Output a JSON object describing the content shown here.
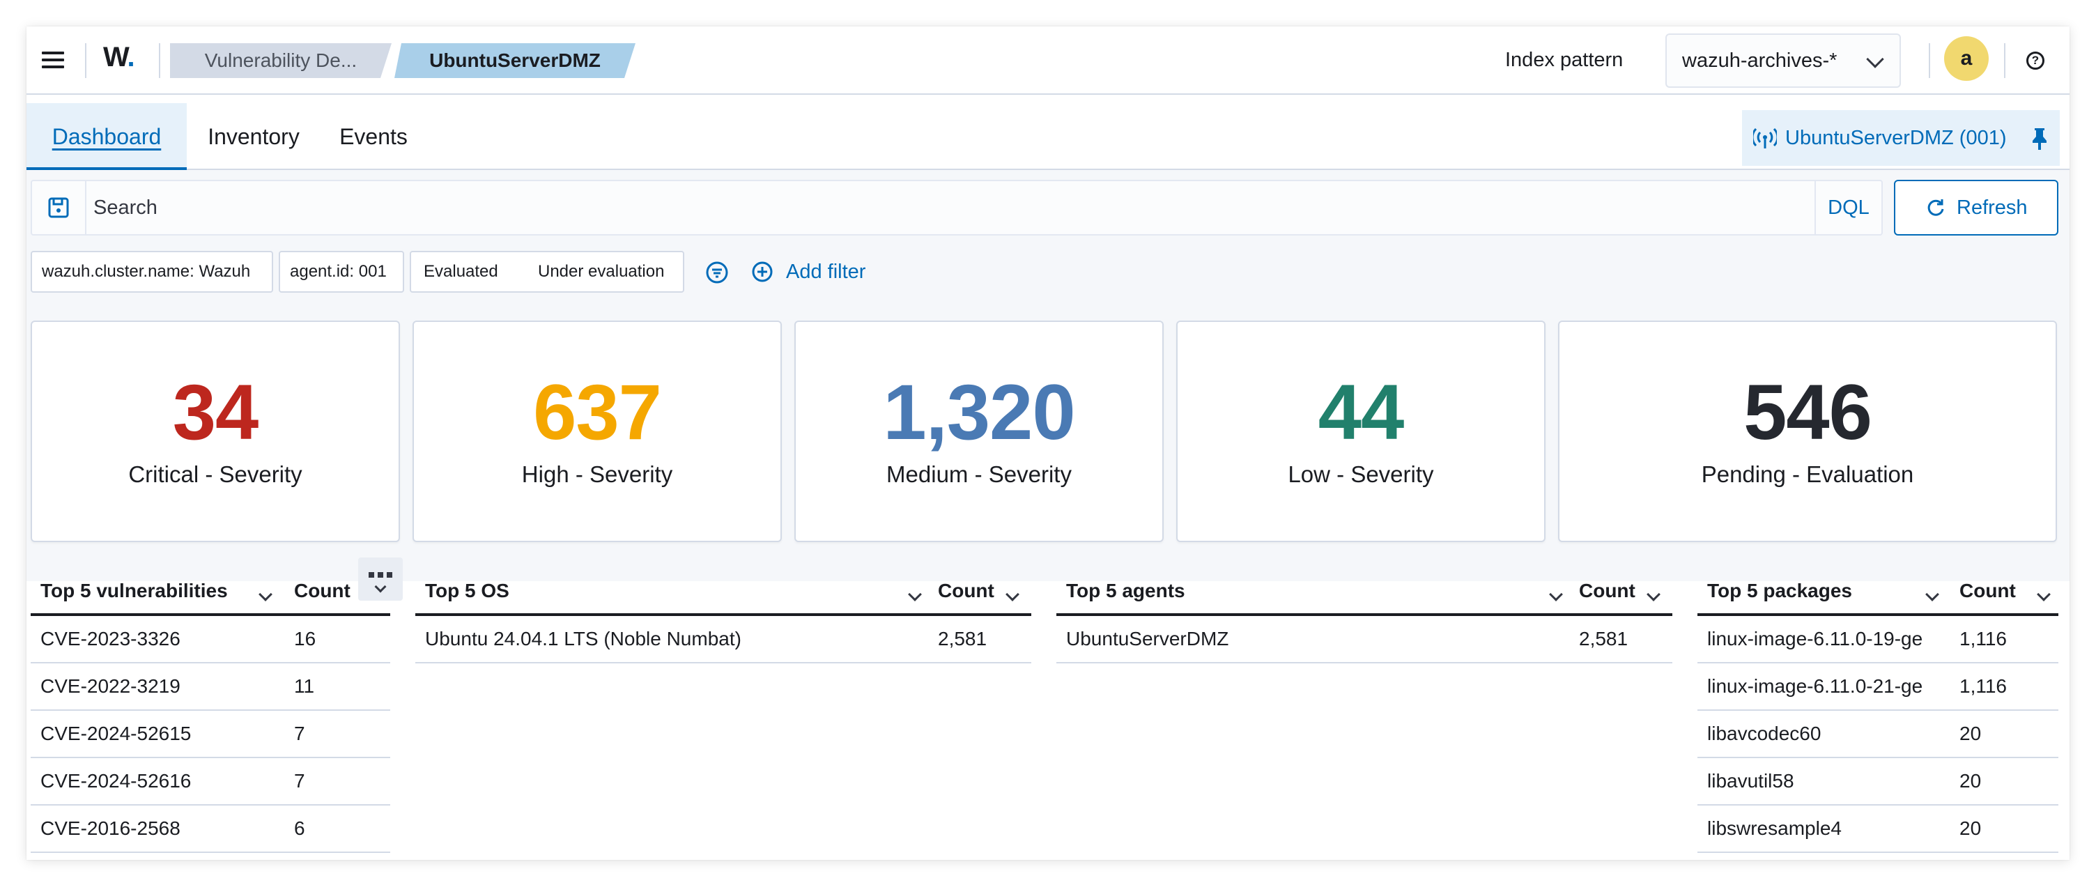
{
  "header": {
    "logo": "W",
    "logo_dot": ".",
    "breadcrumbs": [
      "Vulnerability De...",
      "UbuntuServerDMZ"
    ],
    "index_pattern_label": "Index pattern",
    "index_pattern_value": "wazuh-archives-*",
    "avatar_initial": "a"
  },
  "tabs": [
    "Dashboard",
    "Inventory",
    "Events"
  ],
  "agent_pill": "UbuntuServerDMZ (001)",
  "search": {
    "placeholder": "Search",
    "language": "DQL",
    "refresh_label": "Refresh"
  },
  "filters": {
    "pills": [
      "wazuh.cluster.name: Wazuh",
      "agent.id: 001"
    ],
    "group": [
      "Evaluated",
      "Under evaluation"
    ],
    "add_filter": "Add filter"
  },
  "metrics": [
    {
      "value": "34",
      "label": "Critical - Severity",
      "color": "#bd271e"
    },
    {
      "value": "637",
      "label": "High - Severity",
      "color": "#f5a700"
    },
    {
      "value": "1,320",
      "label": "Medium - Severity",
      "color": "#4a7ab4"
    },
    {
      "value": "44",
      "label": "Low - Severity",
      "color": "#21806c"
    },
    {
      "value": "546",
      "label": "Pending - Evaluation",
      "color": "#25282f"
    }
  ],
  "tables": [
    {
      "title": "Top 5 vulnerabilities",
      "count_label": "Count",
      "rows": [
        [
          "CVE-2023-3326",
          "16"
        ],
        [
          "CVE-2022-3219",
          "11"
        ],
        [
          "CVE-2024-52615",
          "7"
        ],
        [
          "CVE-2024-52616",
          "7"
        ],
        [
          "CVE-2016-2568",
          "6"
        ]
      ]
    },
    {
      "title": "Top 5 OS",
      "count_label": "Count",
      "rows": [
        [
          "Ubuntu 24.04.1 LTS (Noble Numbat)",
          "2,581"
        ]
      ]
    },
    {
      "title": "Top 5 agents",
      "count_label": "Count",
      "rows": [
        [
          "UbuntuServerDMZ",
          "2,581"
        ]
      ]
    },
    {
      "title": "Top 5 packages",
      "count_label": "Count",
      "rows": [
        [
          "linux-image-6.11.0-19-ge",
          "1,116"
        ],
        [
          "linux-image-6.11.0-21-ge",
          "1,116"
        ],
        [
          "libavcodec60",
          "20"
        ],
        [
          "libavutil58",
          "20"
        ],
        [
          "libswresample4",
          "20"
        ]
      ]
    }
  ]
}
